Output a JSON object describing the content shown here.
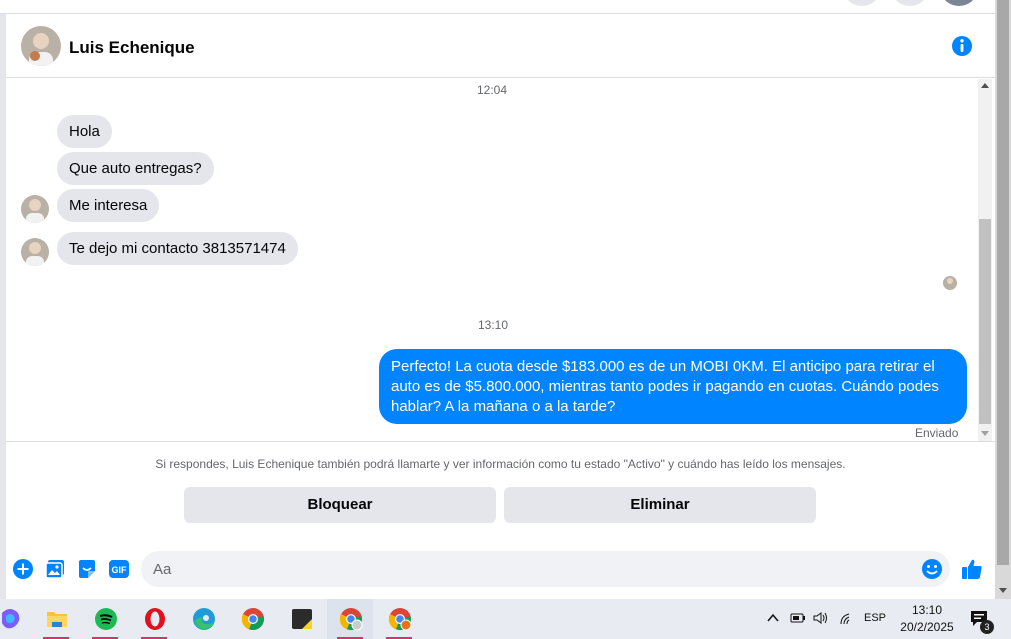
{
  "chat": {
    "contact_name": "Luis Echenique",
    "messages": [
      {
        "type": "time",
        "text": "12:04"
      },
      {
        "type": "in",
        "text": "Hola"
      },
      {
        "type": "in",
        "text": "Que auto entregas?"
      },
      {
        "type": "in",
        "text": "Me interesa"
      },
      {
        "type": "in",
        "text": "Te dejo mi contacto 3813571474"
      },
      {
        "type": "time",
        "text": "13:10"
      },
      {
        "type": "out",
        "text": "Perfecto! La cuota desde $183.000 es de un MOBI 0KM. El anticipo para retirar el auto es de $5.800.000, mientras tanto podes ir pagando en cuotas. Cuándo podes hablar? A la mañana o a la tarde?"
      }
    ],
    "sent_status": "Enviado"
  },
  "notice": {
    "text": "Si respondes, Luis Echenique también podrá llamarte y ver información como tu estado \"Activo\" y cuándo has leído los mensajes.",
    "block_label": "Bloquear",
    "delete_label": "Eliminar"
  },
  "composer": {
    "placeholder": "Aa",
    "gif_label": "GIF"
  },
  "taskbar": {
    "time": "13:10",
    "date": "20/2/2025",
    "language": "ESP",
    "notification_count": "3"
  },
  "colors": {
    "accent": "#0084ff",
    "incoming_bubble": "#e4e6eb"
  }
}
